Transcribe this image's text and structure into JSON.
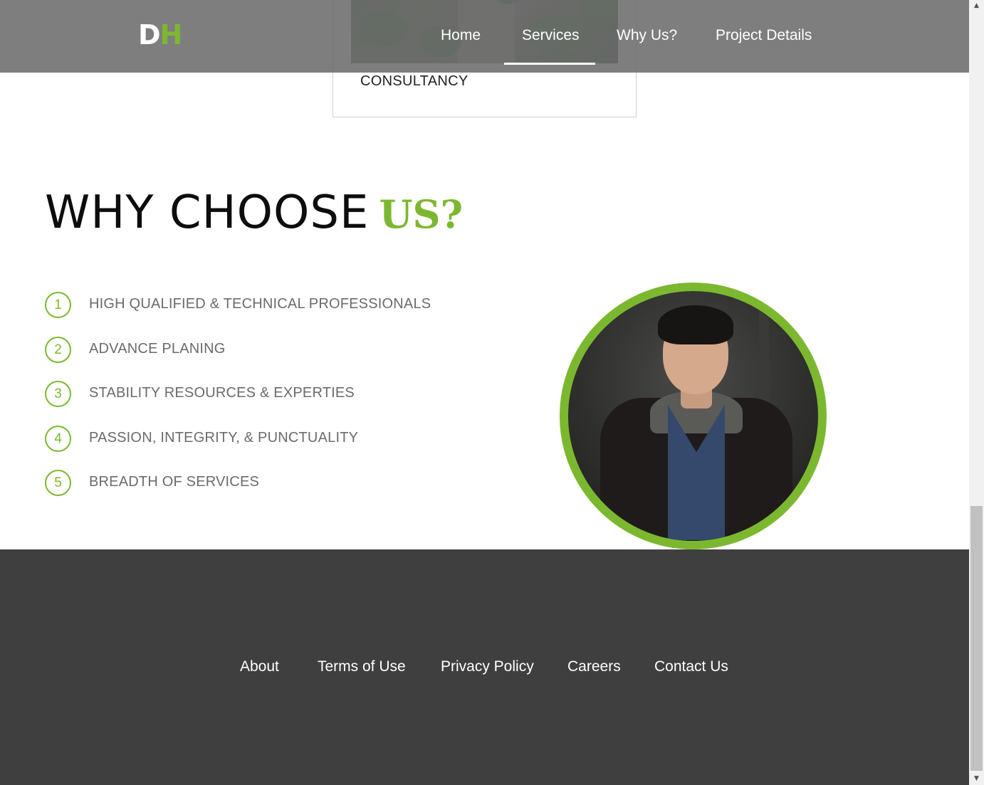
{
  "header": {
    "logo": {
      "first": "D",
      "second": "H"
    },
    "nav": [
      {
        "label": "Home"
      },
      {
        "label": "Services"
      },
      {
        "label": "Why Us?"
      },
      {
        "label": "Project Details"
      }
    ],
    "active_nav": "Services"
  },
  "service_card": {
    "title": "CONSULTANCY"
  },
  "why": {
    "title_main": "WHY CHOOSE",
    "title_accent": "US?",
    "reasons": [
      {
        "num": "1",
        "text": "HIGH QUALIFIED & TECHNICAL PROFESSIONALS"
      },
      {
        "num": "2",
        "text": "ADVANCE PLANING"
      },
      {
        "num": "3",
        "text": "STABILITY RESOURCES & EXPERTIES"
      },
      {
        "num": "4",
        "text": "PASSION, INTEGRITY, & PUNCTUALITY"
      },
      {
        "num": "5",
        "text": "BREADTH OF SERVICES"
      }
    ]
  },
  "footer": {
    "links": [
      {
        "label": "About"
      },
      {
        "label": "Terms of Use"
      },
      {
        "label": "Privacy Policy"
      },
      {
        "label": "Careers"
      },
      {
        "label": "Contact Us"
      }
    ]
  },
  "colors": {
    "accent": "#7cb82f",
    "header_bg": "#6c6c6c",
    "footer_bg": "#3f3f3f",
    "body_text": "#6b6b6b"
  }
}
